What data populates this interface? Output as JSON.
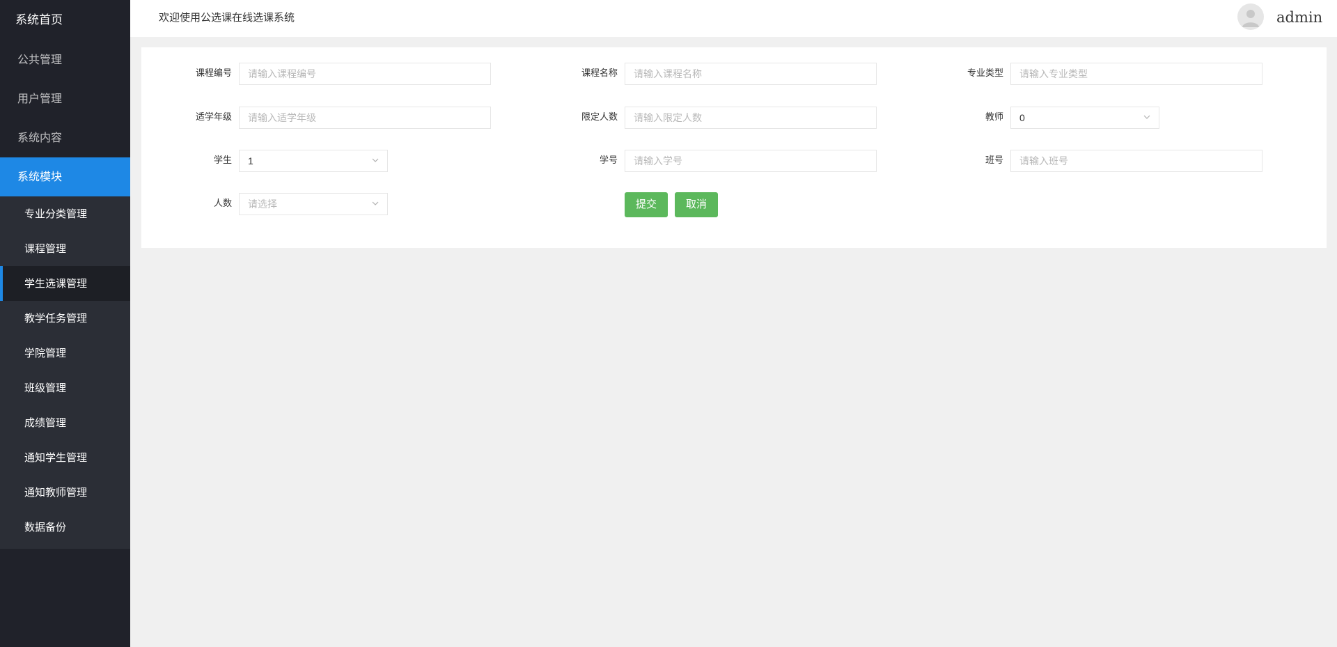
{
  "sidebar": {
    "brand": "系统首页",
    "top_items": [
      "公共管理",
      "用户管理",
      "系统内容"
    ],
    "active_group": "系统模块",
    "sub_items": [
      "专业分类管理",
      "课程管理",
      "学生选课管理",
      "教学任务管理",
      "学院管理",
      "班级管理",
      "成绩管理",
      "通知学生管理",
      "通知教师管理",
      "数据备份"
    ],
    "active_sub_item": "学生选课管理"
  },
  "header": {
    "welcome": "欢迎使用公选课在线选课系统",
    "avatar_icon": "user-avatar-icon",
    "username": "admin"
  },
  "form": {
    "course_code": {
      "label": "课程编号",
      "placeholder": "请输入课程编号",
      "value": ""
    },
    "course_name": {
      "label": "课程名称",
      "placeholder": "请输入课程名称",
      "value": ""
    },
    "major_type": {
      "label": "专业类型",
      "placeholder": "请输入专业类型",
      "value": ""
    },
    "grade": {
      "label": "适学年级",
      "placeholder": "请输入适学年级",
      "value": ""
    },
    "limit_count": {
      "label": "限定人数",
      "placeholder": "请输入限定人数",
      "value": ""
    },
    "teacher": {
      "label": "教师",
      "value": "0"
    },
    "student": {
      "label": "学生",
      "value": "1"
    },
    "student_no": {
      "label": "学号",
      "placeholder": "请输入学号",
      "value": ""
    },
    "class_no": {
      "label": "班号",
      "placeholder": "请输入班号",
      "value": ""
    },
    "count": {
      "label": "人数",
      "placeholder": "请选择",
      "value": ""
    },
    "submit_label": "提交",
    "cancel_label": "取消"
  },
  "colors": {
    "sidebar_bg": "#20222a",
    "sidebar_sub_bg": "#2b2e36",
    "accent": "#1e88e5",
    "button": "#5cb85c",
    "page_bg": "#f0f0f0"
  }
}
